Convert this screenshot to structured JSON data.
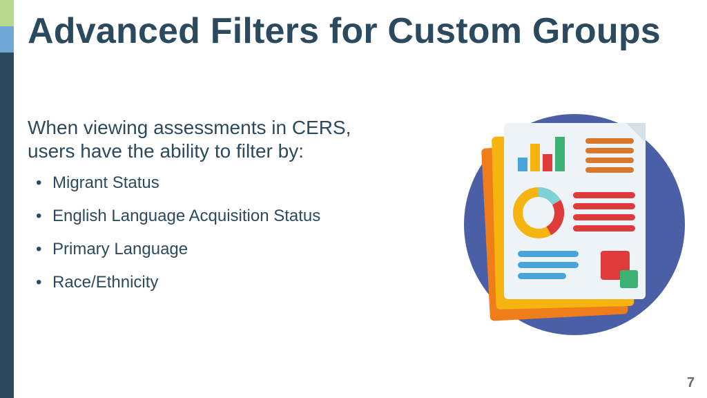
{
  "title": "Advanced Filters for Custom Groups",
  "intro": "When viewing assessments in CERS, users have the ability to filter by:",
  "bullets": [
    "Migrant Status",
    "English Language Acquisition Status",
    "Primary Language",
    "Race/Ethnicity"
  ],
  "page_number": "7",
  "colors": {
    "dark": "#2c4a5e",
    "green_accent": "#b8d98b",
    "blue_accent": "#6fa9d6"
  }
}
